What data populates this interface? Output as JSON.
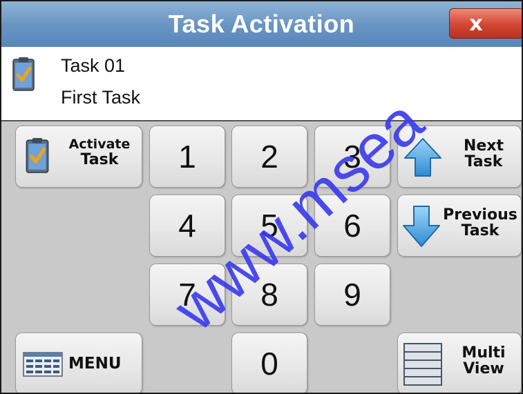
{
  "window": {
    "title": "Task Activation",
    "close_label": "x",
    "accent_color": "#6a96c4",
    "close_color": "#d44a37"
  },
  "task": {
    "id": "Task 01",
    "name": "First Task",
    "icon": "clipboard-check-icon"
  },
  "buttons": {
    "activate_line1": "Activate",
    "activate_line2": "Task",
    "next_line1": "Next",
    "next_line2": "Task",
    "previous_line1": "Previous",
    "previous_line2": "Task",
    "menu": "MENU",
    "multi_line1": "Multi",
    "multi_line2": "View"
  },
  "keypad": {
    "d1": "1",
    "d2": "2",
    "d3": "3",
    "d4": "4",
    "d5": "5",
    "d6": "6",
    "d7": "7",
    "d8": "8",
    "d9": "9",
    "d0": "0"
  },
  "watermark": "www.msea"
}
